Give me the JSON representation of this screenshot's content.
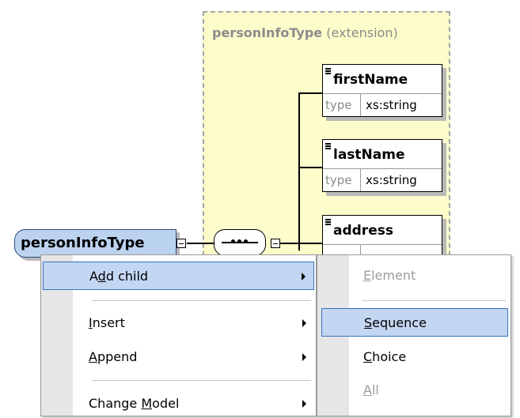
{
  "diagram": {
    "extension_label_bold": "personInfoType",
    "extension_label_suffix": " (extension)",
    "root_type": "personInfoType",
    "elements": [
      {
        "name": "firstName",
        "type_key": "type",
        "type_value": "xs:string"
      },
      {
        "name": "lastName",
        "type_key": "type",
        "type_value": "xs:string"
      },
      {
        "name": "address",
        "type_key": "",
        "type_value": ""
      }
    ]
  },
  "context_menu": {
    "items": [
      {
        "pre": "A",
        "acc": "d",
        "post": "d child",
        "has_submenu": true,
        "highlighted": true
      },
      {
        "pre": "",
        "acc": "I",
        "post": "nsert",
        "has_submenu": true,
        "highlighted": false
      },
      {
        "pre": "",
        "acc": "A",
        "post": "ppend",
        "has_submenu": true,
        "highlighted": false
      },
      {
        "pre": "Change ",
        "acc": "M",
        "post": "odel",
        "has_submenu": true,
        "highlighted": false
      }
    ]
  },
  "submenu": {
    "items": [
      {
        "pre": "",
        "acc": "E",
        "post": "lement",
        "disabled": true,
        "highlighted": false
      },
      {
        "pre": "",
        "acc": "S",
        "post": "equence",
        "disabled": false,
        "highlighted": true
      },
      {
        "pre": "",
        "acc": "C",
        "post": "hoice",
        "disabled": false,
        "highlighted": false
      },
      {
        "pre": "",
        "acc": "A",
        "post": "ll",
        "disabled": true,
        "highlighted": false
      }
    ]
  },
  "colors": {
    "extension_bg": "#fdfccb",
    "type_pill_bg": "#bcd3f0",
    "highlight_bg": "#c3d7f2",
    "highlight_border": "#3472c2"
  }
}
